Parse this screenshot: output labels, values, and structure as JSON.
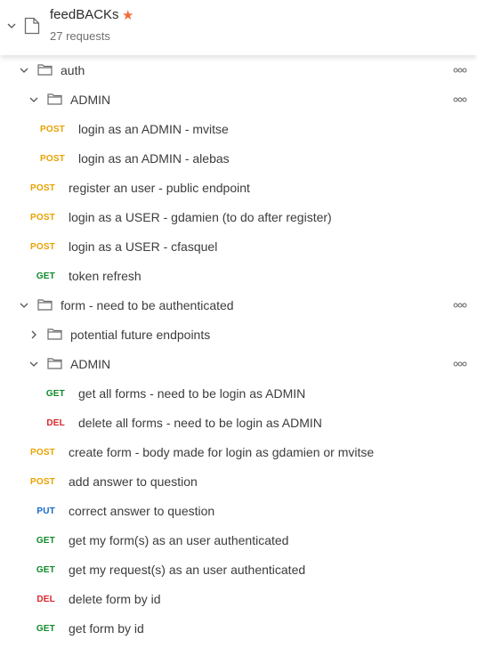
{
  "collection": {
    "title": "feedBACKs",
    "subtitle": "27 requests",
    "star_color": "#f26b3a"
  },
  "colors": {
    "POST": "#e8a200",
    "GET": "#0f8a2a",
    "DEL": "#d9262c",
    "PUT": "#1667c8"
  },
  "items": [
    {
      "type": "folder",
      "label": "auth",
      "indent": 1,
      "open": true,
      "more": true
    },
    {
      "type": "folder",
      "label": "ADMIN",
      "indent": 2,
      "open": true,
      "more": true
    },
    {
      "type": "request",
      "method": "POST",
      "label": "login as an ADMIN - mvitse",
      "indent": 3
    },
    {
      "type": "request",
      "method": "POST",
      "label": "login as an ADMIN - alebas",
      "indent": 3
    },
    {
      "type": "request",
      "method": "POST",
      "label": "register an user - public endpoint",
      "indent": 2
    },
    {
      "type": "request",
      "method": "POST",
      "label": "login as a USER - gdamien (to do after register)",
      "indent": 2
    },
    {
      "type": "request",
      "method": "POST",
      "label": "login as a USER - cfasquel",
      "indent": 2
    },
    {
      "type": "request",
      "method": "GET",
      "label": "token refresh",
      "indent": 2
    },
    {
      "type": "folder",
      "label": "form - need to be authenticated",
      "indent": 1,
      "open": true,
      "more": true
    },
    {
      "type": "folder",
      "label": "potential future endpoints",
      "indent": 2,
      "open": false,
      "more": false
    },
    {
      "type": "folder",
      "label": "ADMIN",
      "indent": 2,
      "open": true,
      "more": true
    },
    {
      "type": "request",
      "method": "GET",
      "label": "get all forms - need to be login as ADMIN",
      "indent": 3
    },
    {
      "type": "request",
      "method": "DEL",
      "label": "delete all forms - need to be login as ADMIN",
      "indent": 3
    },
    {
      "type": "request",
      "method": "POST",
      "label": "create form - body made for login as gdamien or mvitse",
      "indent": 2
    },
    {
      "type": "request",
      "method": "POST",
      "label": "add answer to question",
      "indent": 2
    },
    {
      "type": "request",
      "method": "PUT",
      "label": "correct answer to question",
      "indent": 2
    },
    {
      "type": "request",
      "method": "GET",
      "label": "get my form(s) as an user authenticated",
      "indent": 2
    },
    {
      "type": "request",
      "method": "GET",
      "label": "get my request(s) as an user authenticated",
      "indent": 2
    },
    {
      "type": "request",
      "method": "DEL",
      "label": "delete form by id",
      "indent": 2
    },
    {
      "type": "request",
      "method": "GET",
      "label": "get form by id",
      "indent": 2
    }
  ]
}
